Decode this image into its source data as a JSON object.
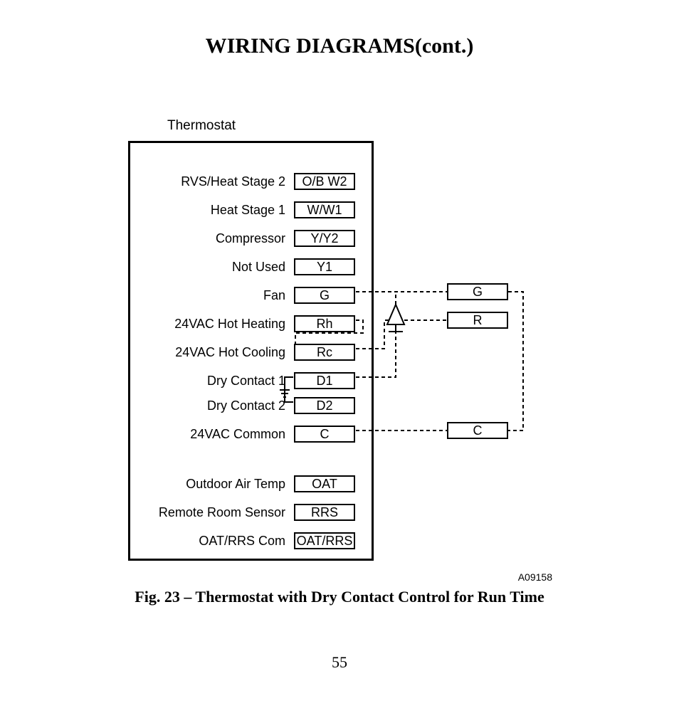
{
  "title": "WIRING DIAGRAMS(cont.)",
  "device_label": "Thermostat",
  "terminals": [
    {
      "label": "RVS/Heat Stage 2",
      "code": "O/B W2"
    },
    {
      "label": "Heat Stage 1",
      "code": "W/W1"
    },
    {
      "label": "Compressor",
      "code": "Y/Y2"
    },
    {
      "label": "Not Used",
      "code": "Y1"
    },
    {
      "label": "Fan",
      "code": "G"
    },
    {
      "label": "24VAC Hot Heating",
      "code": "Rh"
    },
    {
      "label": "24VAC Hot Cooling",
      "code": "Rc"
    },
    {
      "label": "Dry Contact 1",
      "code": "D1"
    },
    {
      "label": "Dry Contact 2",
      "code": "D2"
    },
    {
      "label": "24VAC Common",
      "code": "C"
    }
  ],
  "lower_terminals": [
    {
      "label": "Outdoor Air Temp",
      "code": "OAT"
    },
    {
      "label": "Remote Room Sensor",
      "code": "RRS"
    },
    {
      "label": "OAT/RRS Com",
      "code": "OAT/RRS"
    }
  ],
  "external_terminals": {
    "g": "G",
    "r": "R",
    "c": "C"
  },
  "drawing_code": "A09158",
  "caption": "Fig. 23 – Thermostat with Dry Contact Control for Run Time",
  "page_number": "55"
}
